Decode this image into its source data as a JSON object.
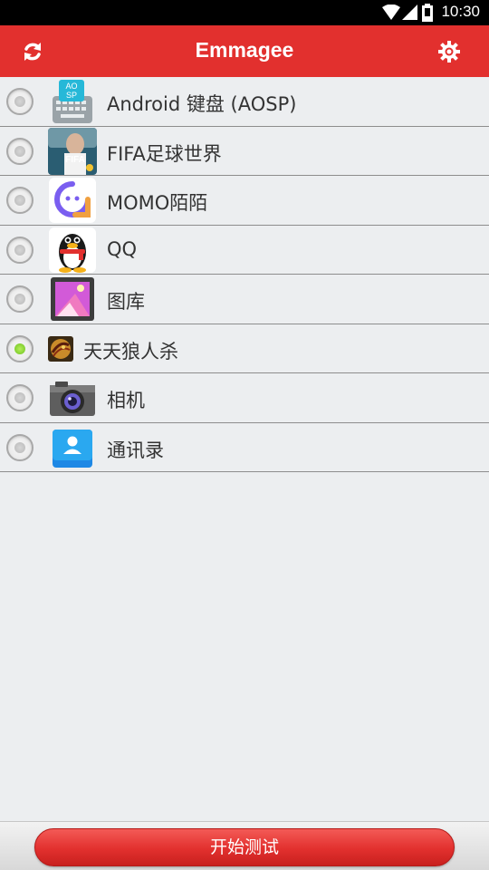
{
  "status_bar": {
    "time": "10:30",
    "icons": [
      "wifi-icon",
      "signal-icon",
      "battery-icon"
    ]
  },
  "toolbar": {
    "title": "Emmagee",
    "left_icon": "refresh-icon",
    "right_icon": "gear-icon",
    "background_color": "#e2302e"
  },
  "apps": [
    {
      "label": "Android 键盘 (AOSP)",
      "icon": "keyboard-app-icon",
      "checked": false
    },
    {
      "label": "FIFA足球世界",
      "icon": "fifa-app-icon",
      "checked": false
    },
    {
      "label": "MOMO陌陌",
      "icon": "momo-app-icon",
      "checked": false
    },
    {
      "label": "QQ",
      "icon": "qq-penguin-icon",
      "checked": false
    },
    {
      "label": "图库",
      "icon": "gallery-app-icon",
      "checked": false
    },
    {
      "label": "天天狼人杀",
      "icon": "werewolf-app-icon",
      "checked": true
    },
    {
      "label": "相机",
      "icon": "camera-app-icon",
      "checked": false
    },
    {
      "label": "通讯录",
      "icon": "contacts-app-icon",
      "checked": false
    }
  ],
  "bottom": {
    "start_button_label": "开始测试"
  },
  "colors": {
    "accent_red": "#e2302e",
    "checked_green": "#6cc21e",
    "background": "#eceef0"
  }
}
